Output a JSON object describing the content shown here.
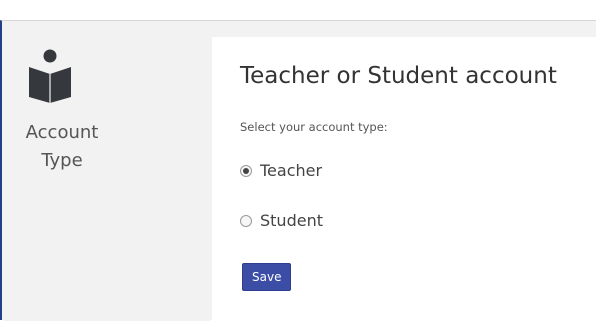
{
  "sidebar": {
    "icon": "reader-book-icon",
    "label": "Account\nType"
  },
  "panel": {
    "title": "Teacher or Student account",
    "subtitle": "Select your account type:",
    "options": [
      {
        "label": "Teacher",
        "selected": true
      },
      {
        "label": "Student",
        "selected": false
      }
    ],
    "save_label": "Save"
  },
  "colors": {
    "accent": "#3b4da5",
    "icon": "#35393e",
    "sidebar_bg": "#f2f2f2",
    "frame_border": "#233f86"
  }
}
